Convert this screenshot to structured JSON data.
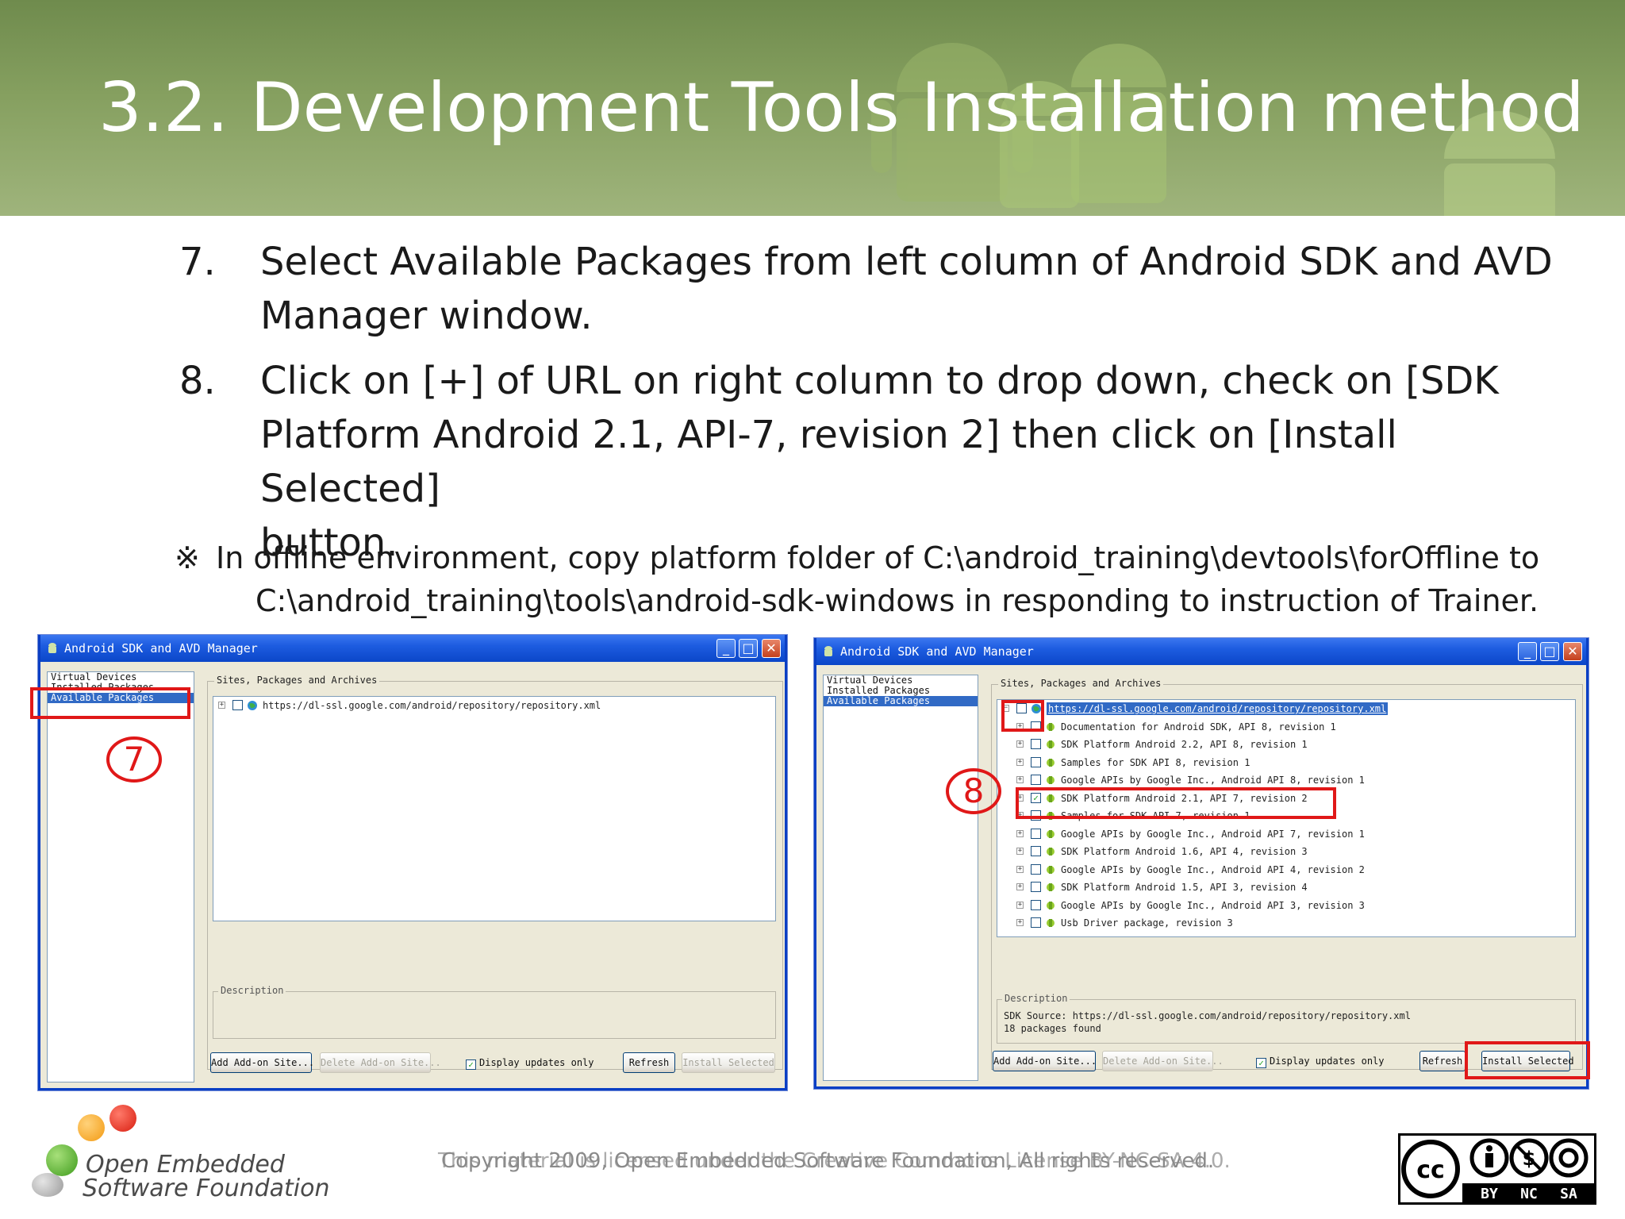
{
  "slide": {
    "title": "3.2. Development Tools Installation method",
    "steps": [
      {
        "num": "7.",
        "lines": [
          "Select Available Packages from left column of Android SDK and AVD",
          "Manager window."
        ]
      },
      {
        "num": "8.",
        "lines": [
          "Click on [+] of URL on right column to drop down, check on [SDK",
          "Platform Android 2.1, API-7, revision 2] then click on [Install Selected]",
          "button."
        ]
      }
    ],
    "note": {
      "mark": "※",
      "line1": "In offline environment, copy platform folder of C:\\android_training\\devtools\\forOffline to",
      "line2": "C:\\android_training\\tools\\android-sdk-windows in responding to instruction of Trainer."
    }
  },
  "window_left": {
    "title": "Android SDK and AVD Manager",
    "nav": [
      "Virtual Devices",
      "Installed Packages",
      "Available Packages"
    ],
    "group_label": "Sites, Packages and Archives",
    "site_url": "https://dl-ssl.google.com/android/repository/repository.xml",
    "description_label": "Description",
    "buttons": {
      "add_site": "Add Add-on Site...",
      "delete_site": "Delete Add-on Site...",
      "display_updates": "Display updates only",
      "refresh": "Refresh",
      "install": "Install Selected"
    },
    "annotation": "7"
  },
  "window_right": {
    "title": "Android SDK and AVD Manager",
    "nav": [
      "Virtual Devices",
      "Installed Packages",
      "Available Packages"
    ],
    "group_label": "Sites, Packages and Archives",
    "site_url": "https://dl-ssl.google.com/android/repository/repository.xml",
    "packages": [
      "Documentation for Android SDK, API 8, revision 1",
      "SDK Platform Android 2.2, API 8, revision 1",
      "Samples for SDK API 8, revision 1",
      "Google APIs by Google Inc., Android API 8, revision 1",
      "SDK Platform Android 2.1, API 7, revision 2",
      "Samples for SDK API 7, revision 1",
      "Google APIs by Google Inc., Android API 7, revision 1",
      "SDK Platform Android 1.6, API 4, revision 3",
      "Google APIs by Google Inc., Android API 4, revision 2",
      "SDK Platform Android 1.5, API 3, revision 4",
      "Google APIs by Google Inc., Android API 3, revision 3",
      "Usb Driver package, revision 3"
    ],
    "description_label": "Description",
    "description_lines": [
      "SDK Source: https://dl-ssl.google.com/android/repository/repository.xml",
      "18 packages found"
    ],
    "buttons": {
      "add_site": "Add Add-on Site...",
      "delete_site": "Delete Add-on Site...",
      "display_updates": "Display updates only",
      "refresh": "Refresh",
      "install": "Install Selected"
    },
    "annotation": "8"
  },
  "footer": {
    "logo_line1": "Open Embedded",
    "logo_line2": "Software Foundation",
    "copyright": "Copyright 2009, Open Embedded Software Foundation, All rights reserved.",
    "license_overlay": "This material is licensed under the Creative Commons License BY-NC-SA 4.0.",
    "cc_labels": [
      "BY",
      "NC",
      "SA"
    ]
  },
  "colors": {
    "header_green": "#7d9656",
    "title_bar_blue": "#0b46c8",
    "annotation_red": "#e01818",
    "selection_blue": "#316ac5"
  }
}
